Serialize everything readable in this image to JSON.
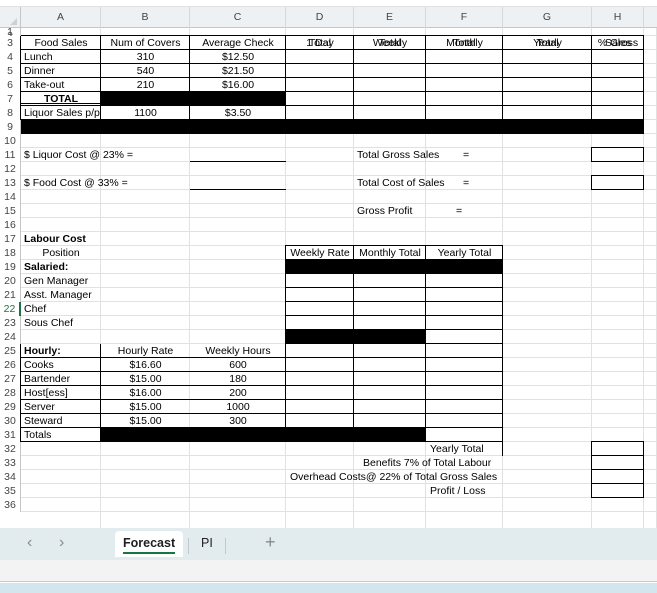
{
  "columns": [
    "A",
    "B",
    "C",
    "D",
    "E",
    "F",
    "G",
    "H"
  ],
  "rows": [
    "1",
    "2",
    "3",
    "4",
    "5",
    "6",
    "7",
    "8",
    "9",
    "10",
    "11",
    "12",
    "13",
    "14",
    "15",
    "16",
    "17",
    "18",
    "19",
    "20",
    "21",
    "22",
    "23",
    "24",
    "25",
    "26",
    "27",
    "28",
    "29",
    "30",
    "31",
    "32",
    "33",
    "34",
    "35",
    "36"
  ],
  "active_row": "22",
  "food_sales": {
    "headers": {
      "a": "Food Sales",
      "b": "Num of Covers",
      "c": "Average Check",
      "d1": "1 Day",
      "d2": "Total",
      "e1": "Weekly",
      "e2": "Total",
      "f1": "Monthly",
      "f2": "Total",
      "g1": "Yearly",
      "g2": "Total",
      "h1": "% Gross",
      "h2": "Sales"
    },
    "items": [
      {
        "label": "Lunch",
        "covers": "310",
        "check": "$12.50"
      },
      {
        "label": "Dinner",
        "covers": "540",
        "check": "$21.50"
      },
      {
        "label": "Take-out",
        "covers": "210",
        "check": "$16.00"
      }
    ],
    "total_label": "TOTAL",
    "liquor": {
      "label": "Liquor Sales p/p",
      "covers": "1100",
      "check": "$3.50"
    }
  },
  "costs": {
    "liquor_cost": "$ Liquor Cost @ 23%  =",
    "food_cost": "$ Food Cost @ 33%   =",
    "total_gross_sales": "Total Gross Sales",
    "total_cost_of_sales": "Total Cost of Sales",
    "gross_profit": "Gross Profit",
    "equals": "="
  },
  "labour": {
    "title": "Labour Cost",
    "position_label": "Position",
    "rate_headers": [
      "Weekly Rate",
      "Monthly Total",
      "Yearly Total"
    ],
    "salaried_label": "Salaried:",
    "salaried": [
      "Gen Manager",
      "Asst. Manager",
      "Chef",
      "Sous Chef"
    ],
    "hourly_label": "Hourly:",
    "hourly_rate_header": "Hourly Rate",
    "weekly_hours_header": "Weekly Hours",
    "hourly": [
      {
        "label": "Cooks",
        "rate": "$16.60",
        "hours": "600"
      },
      {
        "label": "Bartender",
        "rate": "$15.00",
        "hours": "180"
      },
      {
        "label": "Host[ess]",
        "rate": "$16.00",
        "hours": "200"
      },
      {
        "label": "Server",
        "rate": "$15.00",
        "hours": "1000"
      },
      {
        "label": "Steward",
        "rate": "$15.00",
        "hours": "300"
      }
    ],
    "totals_label": "Totals"
  },
  "summary": {
    "yearly_total": "Yearly Total",
    "benefits": "Benefits 7% of Total Labour",
    "overhead": "Overhead Costs@ 22% of Total Gross Sales",
    "profit_loss": "Profit / Loss"
  },
  "sheet_tabs": {
    "prev": "‹",
    "next": "›",
    "tabs": [
      {
        "label": "Forecast",
        "active": true
      },
      {
        "label": "PI",
        "active": false
      }
    ],
    "add": "+"
  },
  "accent_color": "#1a7343"
}
